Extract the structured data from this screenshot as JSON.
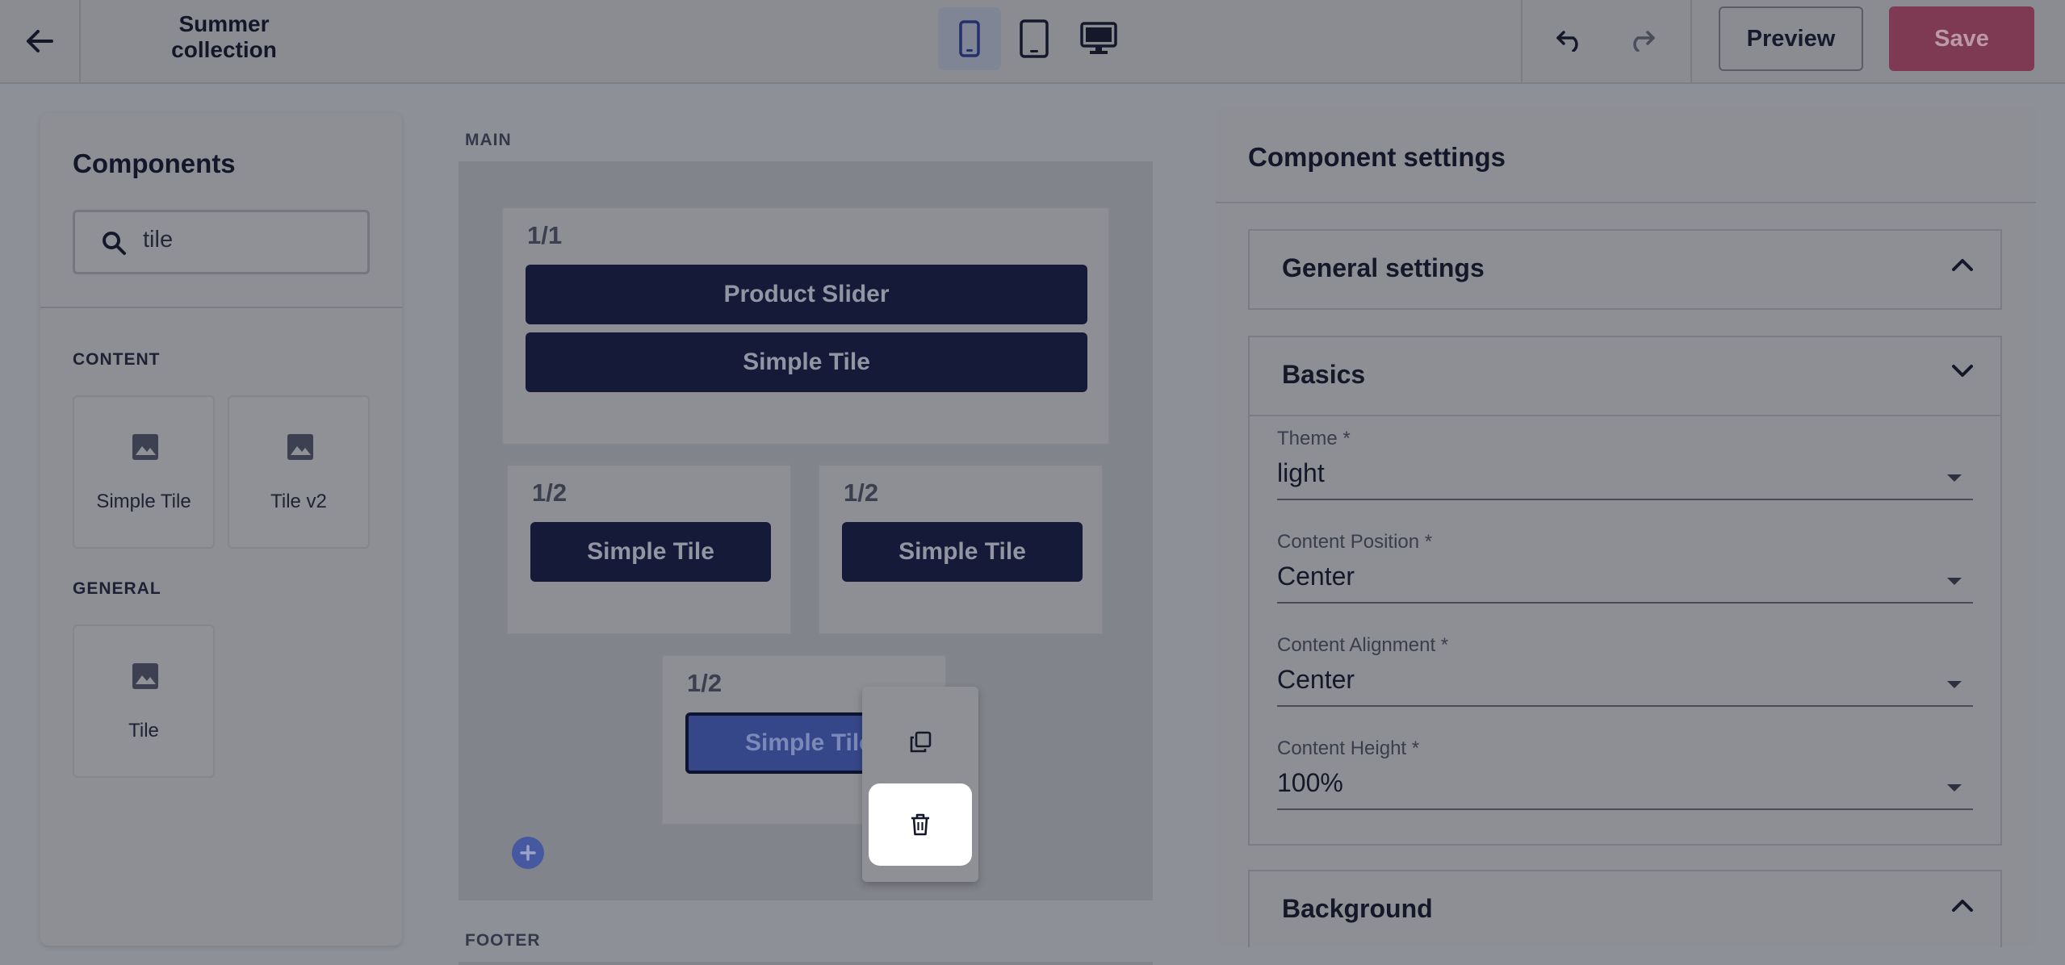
{
  "header": {
    "title_line1": "Summer",
    "title_line2": "collection",
    "preview_label": "Preview",
    "save_label": "Save"
  },
  "left_panel": {
    "title": "Components",
    "search_value": "tile",
    "sections": {
      "content_label": "CONTENT",
      "general_label": "GENERAL"
    },
    "content_items": [
      "Simple Tile",
      "Tile v2"
    ],
    "general_items": [
      "Tile"
    ]
  },
  "canvas": {
    "main_label": "MAIN",
    "footer_label": "FOOTER",
    "blocks": [
      {
        "ratio": "1/1",
        "components": [
          "Product Slider",
          "Simple Tile"
        ]
      },
      {
        "ratio": "1/2",
        "components": [
          "Simple Tile"
        ]
      },
      {
        "ratio": "1/2",
        "components": [
          "Simple Tile"
        ]
      },
      {
        "ratio": "1/2",
        "components": [
          "Simple Tile"
        ]
      }
    ]
  },
  "right_panel": {
    "title": "Component settings",
    "general_settings": "General settings",
    "basics": "Basics",
    "background": "Background",
    "fields": [
      {
        "label": "Theme *",
        "value": "light"
      },
      {
        "label": "Content Position *",
        "value": "Center"
      },
      {
        "label": "Content Alignment *",
        "value": "Center"
      },
      {
        "label": "Content Height *",
        "value": "100%"
      }
    ]
  },
  "colors": {
    "overlay_bg": "#8e9097",
    "accent_navy": "#141a38",
    "save_red": "#7e3a52",
    "selected_blue": "#354788"
  }
}
